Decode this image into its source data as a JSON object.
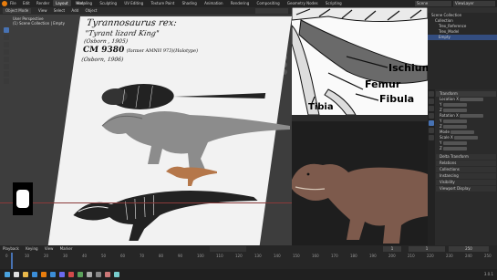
{
  "topbar": {
    "menus": [
      "File",
      "Edit",
      "Render",
      "Window",
      "Help"
    ],
    "workspaces": [
      "Layout",
      "Modeling",
      "Sculpting",
      "UV Editing",
      "Texture Paint",
      "Shading",
      "Animation",
      "Rendering",
      "Compositing",
      "Geometry Nodes",
      "Scripting"
    ],
    "active_workspace": "Layout",
    "scene_label": "Scene",
    "view_layer_label": "ViewLayer"
  },
  "viewport": {
    "mode": "Object Mode",
    "menus": [
      "View",
      "Select",
      "Add",
      "Object"
    ],
    "overlay_title": "User Perspective",
    "overlay_sub": "(1) Scene Collection | Empty"
  },
  "reference_sheet": {
    "title": "Tyrannosaurus rex:",
    "subtitle": "\"Tyrant lizard King\"",
    "author": "(Osborn , 1905)",
    "specimen": "CM 9380",
    "specimen_note": "(former AMNH 973)(Holotype)",
    "author2": "(Osborn, 1906)"
  },
  "anatomy_labels": [
    "Ischium",
    "Femur",
    "Fibula",
    "Tibia"
  ],
  "outliner": {
    "items": [
      "Scene Collection",
      "Collection",
      "Trex_Reference",
      "Trex_Model",
      "Empty"
    ]
  },
  "properties": {
    "section": "Transform",
    "rows": [
      "Location X",
      "Y",
      "Z",
      "Rotation X",
      "Y",
      "Z",
      "Mode",
      "Scale X",
      "Y",
      "Z"
    ],
    "section2": "Delta Transform",
    "section3": "Relations",
    "section4": "Collections",
    "section5": "Instancing",
    "section6": "Visibility",
    "section7": "Viewport Display"
  },
  "timeline": {
    "menus": [
      "Playback",
      "Keying",
      "View",
      "Marker"
    ],
    "current_frame": "1",
    "start": "1",
    "end": "250",
    "ticks": [
      "0",
      "10",
      "20",
      "30",
      "40",
      "50",
      "60",
      "70",
      "80",
      "90",
      "100",
      "110",
      "120",
      "130",
      "140",
      "150",
      "160",
      "170",
      "180",
      "190",
      "200",
      "210",
      "220",
      "230",
      "240",
      "250"
    ]
  },
  "taskbar": {
    "icons": [
      "start-icon",
      "search-icon",
      "files-icon",
      "browser-icon",
      "blender-icon",
      "mail-icon",
      "store-icon",
      "media-icon",
      "app-icon",
      "app-icon",
      "app-icon",
      "app-icon",
      "app-icon"
    ],
    "clock": "3.0.1"
  },
  "colors": {
    "accent": "#4772b3",
    "panel": "#303030",
    "viewport_bg": "#3d3d3d",
    "paper": "#f2f2f2"
  }
}
